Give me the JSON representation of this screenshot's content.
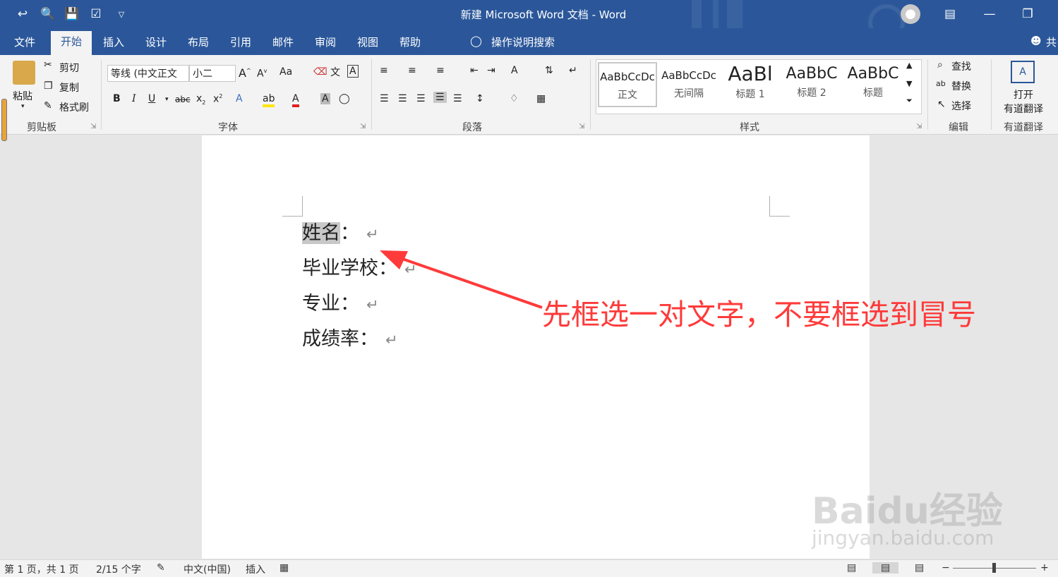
{
  "window": {
    "title": "新建 Microsoft Word 文档 - Word",
    "share_label": "共"
  },
  "tabs": [
    "文件",
    "开始",
    "插入",
    "设计",
    "布局",
    "引用",
    "邮件",
    "审阅",
    "视图",
    "帮助"
  ],
  "active_tab": "开始",
  "tell_me": "操作说明搜索",
  "clipboard": {
    "paste": "粘贴",
    "cut": "剪切",
    "copy": "复制",
    "format_painter": "格式刷",
    "group": "剪贴板"
  },
  "font": {
    "name": "等线 (中文正文",
    "size": "小二",
    "group": "字体",
    "bold": "B",
    "italic": "I",
    "underline": "U",
    "strike": "abc",
    "change_case": "Aa"
  },
  "paragraph": {
    "group": "段落"
  },
  "styles": {
    "group": "样式",
    "items": [
      {
        "sample": "AaBbCcDc",
        "name": "正文"
      },
      {
        "sample": "AaBbCcDc",
        "name": "无间隔"
      },
      {
        "sample": "AaBl",
        "name": "标题 1"
      },
      {
        "sample": "AaBbC",
        "name": "标题 2"
      },
      {
        "sample": "AaBbC",
        "name": "标题"
      }
    ]
  },
  "editing": {
    "find": "查找",
    "replace": "替换",
    "select": "选择",
    "group": "编辑"
  },
  "youdao": {
    "open": "打开",
    "translate": "有道翻译",
    "group": "有道翻译"
  },
  "document": {
    "lines": [
      {
        "label": "姓名",
        "colon": "："
      },
      {
        "label": "毕业学校",
        "colon": "："
      },
      {
        "label": "专业",
        "colon": "："
      },
      {
        "label": "成绩率",
        "colon": "："
      }
    ],
    "paragraph_mark": "↵"
  },
  "annotation": "先框选一对文字，不要框选到冒号",
  "watermark": {
    "brand": "Baidu经验",
    "url": "jingyan.baidu.com"
  },
  "status": {
    "page": "第 1 页，共 1 页",
    "words": "2/15 个字",
    "language": "中文(中国)",
    "mode": "插入"
  },
  "colors": {
    "accent": "#2b579a",
    "annotation": "#ff3a3a",
    "highlight": "#c8c8c8"
  }
}
